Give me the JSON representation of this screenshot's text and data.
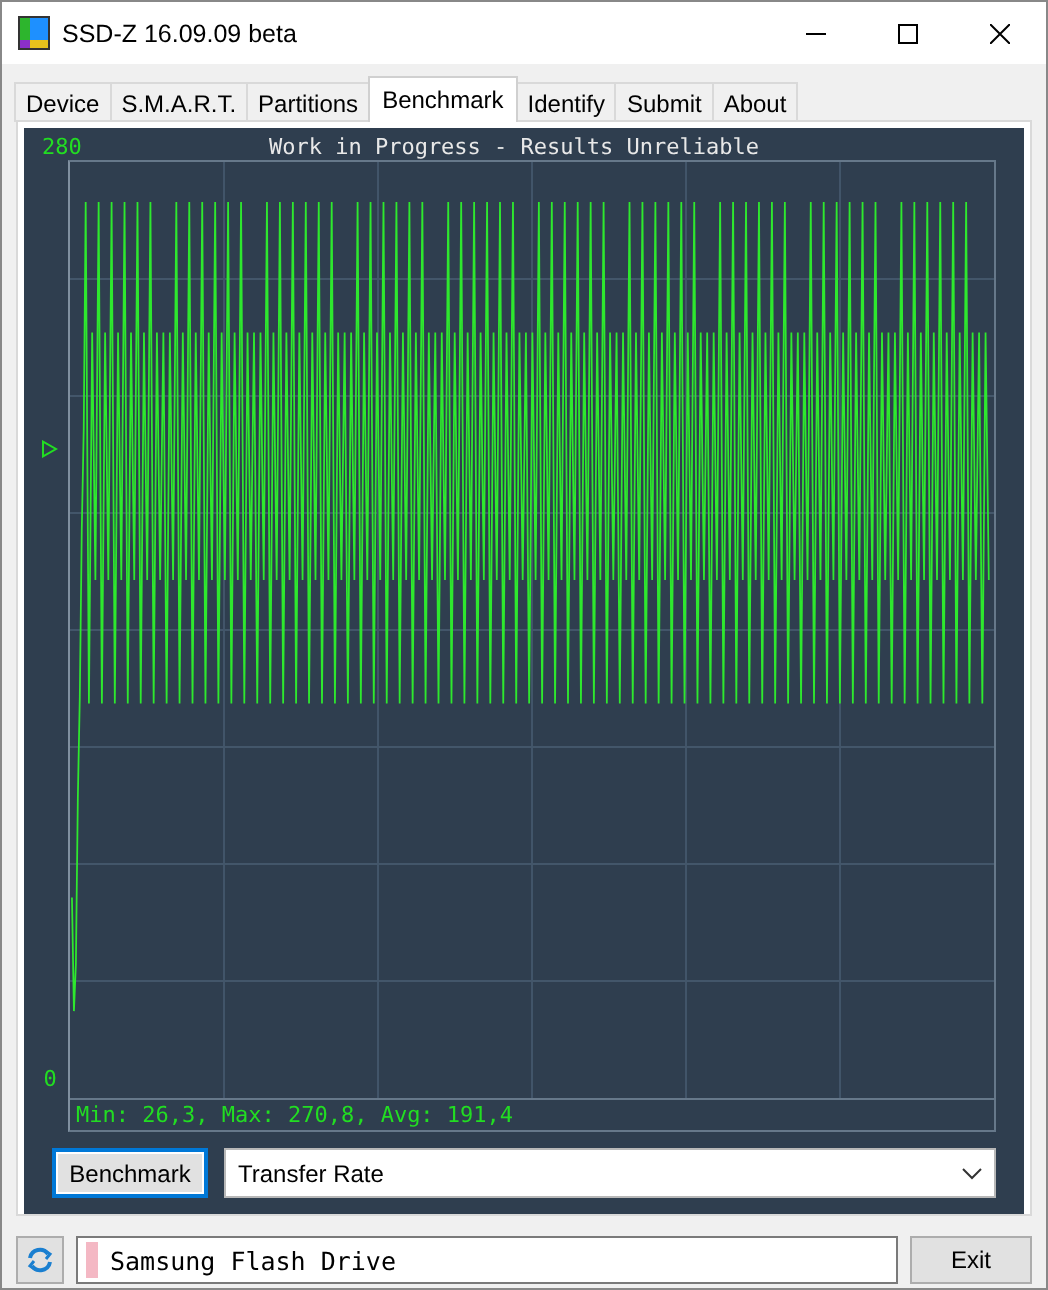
{
  "window": {
    "title": "SSD-Z 16.09.09 beta"
  },
  "tabs": [
    {
      "label": "Device",
      "selected": false
    },
    {
      "label": "S.M.A.R.T.",
      "selected": false
    },
    {
      "label": "Partitions",
      "selected": false
    },
    {
      "label": "Benchmark",
      "selected": true
    },
    {
      "label": "Identify",
      "selected": false
    },
    {
      "label": "Submit",
      "selected": false
    },
    {
      "label": "About",
      "selected": false
    }
  ],
  "graph": {
    "title": "Work in Progress - Results Unreliable",
    "y_max_label": "280",
    "y_min_label": "0",
    "stats": "Min: 26,3, Max: 270,8, Avg: 191,4"
  },
  "benchmark_button": "Benchmark",
  "mode_select": {
    "value": "Transfer Rate"
  },
  "status_bar": {
    "drive": "Samsung Flash Drive",
    "exit_button": "Exit"
  }
}
